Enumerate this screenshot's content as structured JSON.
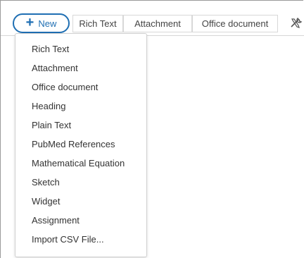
{
  "toolbar": {
    "new_button": {
      "label": "New",
      "icon": "plus-icon"
    },
    "tabs": [
      {
        "label": "Rich Text"
      },
      {
        "label": "Attachment"
      },
      {
        "label": "Office document"
      }
    ],
    "tools_icon": "tools-icon"
  },
  "new_menu": {
    "items": [
      {
        "label": "Rich Text"
      },
      {
        "label": "Attachment"
      },
      {
        "label": "Office document"
      },
      {
        "label": "Heading"
      },
      {
        "label": "Plain Text"
      },
      {
        "label": "PubMed References"
      },
      {
        "label": "Mathematical Equation"
      },
      {
        "label": "Sketch"
      },
      {
        "label": "Widget"
      },
      {
        "label": "Assignment"
      },
      {
        "label": "Import CSV File..."
      }
    ]
  },
  "colors": {
    "accent": "#1f6fb3",
    "text": "#333333",
    "border": "#d0d0d0"
  }
}
